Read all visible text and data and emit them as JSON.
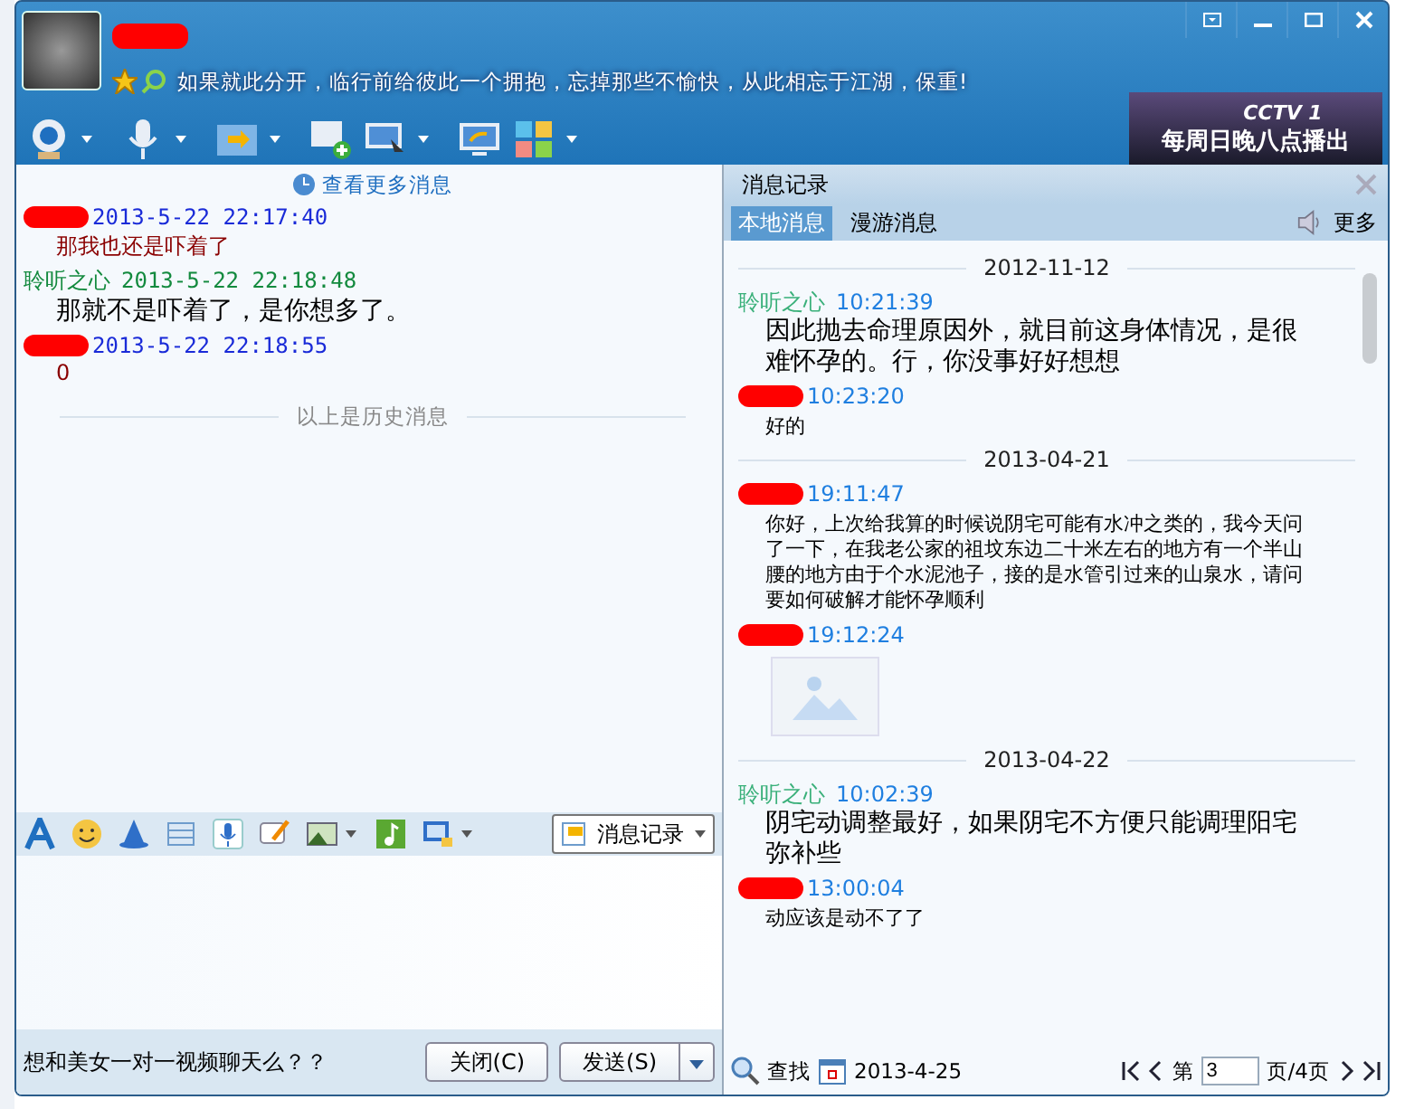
{
  "header": {
    "signature": "如果就此分开，临行前给彼此一个拥抱，忘掉那些不愉快，从此相忘于江湖，保重!",
    "ad_text": "每周日晚八点播出",
    "ad_logo": "CCTV 1"
  },
  "chat": {
    "more_link": "查看更多消息",
    "messages": [
      {
        "kind": "peer",
        "time": "2013-5-22 22:17:40",
        "text": "那我也还是吓着了"
      },
      {
        "kind": "self",
        "sender": "聆听之心",
        "time": "2013-5-22 22:18:48",
        "text": "那就不是吓着了，是你想多了。"
      },
      {
        "kind": "peer",
        "time": "2013-5-22 22:18:55",
        "text": "0"
      }
    ],
    "history_divider": "以上是历史消息",
    "history_button": "消息记录",
    "promo": "想和美女一对一视频聊天么？？",
    "buttons": [
      "关闭(C)",
      "发送(S)"
    ]
  },
  "history": {
    "title": "消息记录",
    "tabs": [
      {
        "label": "本地消息",
        "selected": true
      },
      {
        "label": "漫游消息",
        "selected": false
      }
    ],
    "more": "更多",
    "entries": [
      {
        "kind": "date",
        "text": "2012-11-12"
      },
      {
        "kind": "self",
        "sender": "聆听之心",
        "time": "10:21:39",
        "text": "因此抛去命理原因外，就目前这身体情况，是很难怀孕的。行，你没事好好想想"
      },
      {
        "kind": "peer",
        "time": "10:23:20",
        "text": "好的"
      },
      {
        "kind": "date",
        "text": "2013-04-21"
      },
      {
        "kind": "peer",
        "time": "19:11:47",
        "text": "你好，上次给我算的时候说阴宅可能有水冲之类的，我今天问了一下，在我老公家的祖坟东边二十米左右的地方有一个半山腰的地方由于个水泥池子，接的是水管引过来的山泉水，请问要如何破解才能怀孕顺利"
      },
      {
        "kind": "image",
        "time": "19:12:24"
      },
      {
        "kind": "date",
        "text": "2013-04-22"
      },
      {
        "kind": "self",
        "sender": "聆听之心",
        "time": "10:02:39",
        "text": "阴宅动调整最好，如果阴宅不方便只能调理阳宅弥补些"
      },
      {
        "kind": "peer",
        "time": "13:00:04",
        "text": "动应该是动不了了"
      }
    ],
    "find": "查找",
    "date": "2013-4-25",
    "page_prefix": "第",
    "page_value": "3",
    "page_suffix": "页/4页"
  }
}
